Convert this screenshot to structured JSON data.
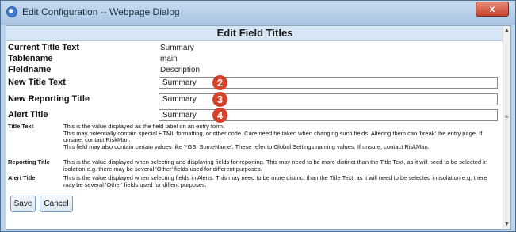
{
  "window": {
    "title": "Edit Configuration -- Webpage Dialog",
    "close_glyph": "x"
  },
  "page": {
    "header": "Edit Field Titles"
  },
  "info": [
    {
      "label": "Current Title Text",
      "value": "Summary"
    },
    {
      "label": "Tablename",
      "value": "main"
    },
    {
      "label": "Fieldname",
      "value": "Description"
    }
  ],
  "fields": {
    "new_title": {
      "label": "New Title Text",
      "value": "Summary",
      "badge": "2"
    },
    "new_reporting": {
      "label": "New Reporting Title",
      "value": "Summary",
      "badge": "3"
    },
    "alert": {
      "label": "Alert Title",
      "value": "Summary",
      "badge": "4"
    }
  },
  "help": {
    "title_text": {
      "label": "Title Text",
      "lines": [
        "This is the value displayed as the field label on an entry form.",
        "This may potentially contain special HTML formatting, or other code. Care need be taken when changing such fields. Altering them can 'break' the entry page. If unsure, contact RiskMan.",
        "This field may also contain certain values like '*GS_SomeName'. These refer to Global Settings naming values. If unsure, contact RiskMan."
      ]
    },
    "reporting_title": {
      "label": "Reporting Title",
      "text": "This is the value displayed when selecting and displaying fields for reporting. This may need to be more distinct than the Title Text, as it will need to be selected in isolation e.g. there may be several 'Other' fields used for different purposes."
    },
    "alert_title": {
      "label": "Alert Title",
      "text": "This is the value displayed when selecting fields in Alerts. This may need to be more distinct than the Title Text, as it will need to be selected in isolation e.g. there may be several 'Other' fields used for diffent purposes."
    }
  },
  "buttons": {
    "save": "Save",
    "cancel": "Cancel"
  },
  "colors": {
    "header_bg": "#d7e6f4",
    "badge": "#d8412a",
    "close": "#c5412b",
    "button_border": "#7a9cc0"
  }
}
